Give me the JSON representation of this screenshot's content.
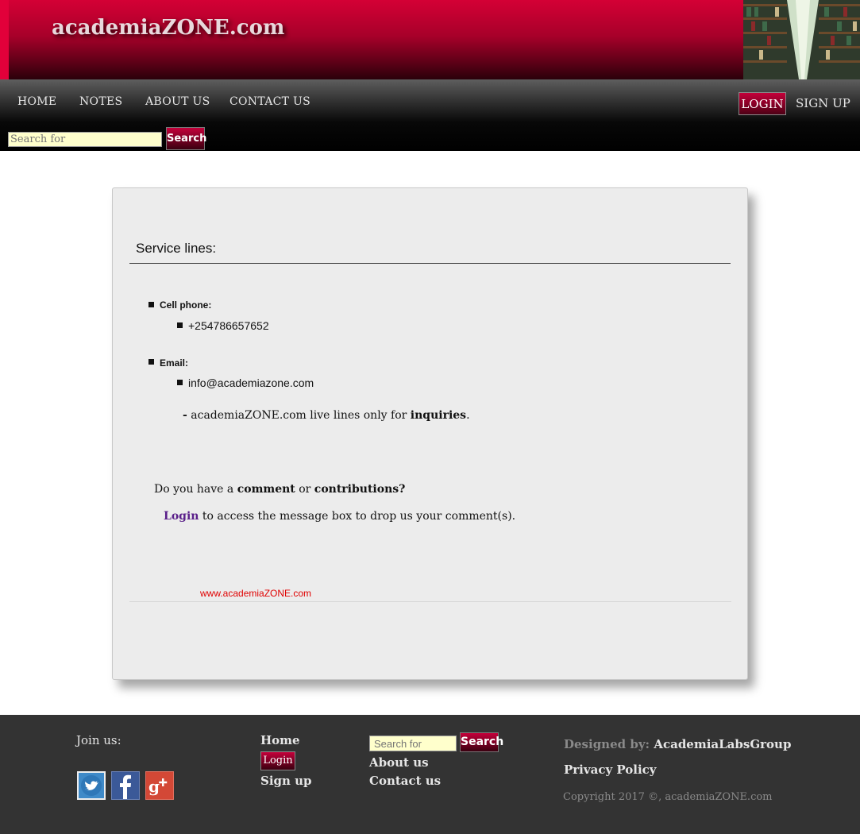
{
  "header": {
    "site_title": "academiaZONE.com"
  },
  "nav": {
    "items": [
      {
        "label": "HOME"
      },
      {
        "label": "NOTES"
      },
      {
        "label": "ABOUT US"
      },
      {
        "label": "CONTACT US"
      }
    ],
    "login_label": "LOGIN",
    "signup_label": "SIGN UP",
    "search_placeholder": "Search for",
    "search_button": "Search"
  },
  "content": {
    "heading": "Service lines:",
    "cell_label": "Cell phone:",
    "cell_value": "+254786657652",
    "email_label": "Email:",
    "email_value": "info@academiazone.com",
    "note_dash": "-",
    "note_text": "academiaZONE.com live lines only for",
    "note_bold": "inquiries",
    "note_end": ".",
    "question_pre": "Do you have a",
    "question_comment": "comment",
    "question_or": "or",
    "question_contrib": "contributions?",
    "login_link": "Login",
    "login_rest": "to access the message box to drop us your comment(s).",
    "site_url": "www.academiaZONE.com"
  },
  "footer": {
    "join_label": "Join us:",
    "home": "Home",
    "login": "Login",
    "signup": "Sign up",
    "search_placeholder": "Search for",
    "search_button": "Search",
    "about": "About us",
    "contact": "Contact us",
    "designed_by_label": "Designed by:",
    "designer": "AcademiaLabsGroup",
    "privacy": "Privacy Policy",
    "copyright": "Copyright 2017 ©, academiaZONE.com",
    "social": [
      {
        "icon": "twitter-icon",
        "color": "#3f8ac8"
      },
      {
        "icon": "facebook-icon",
        "color": "#3b5998"
      },
      {
        "icon": "google-plus-icon",
        "color": "#d34836"
      }
    ]
  }
}
